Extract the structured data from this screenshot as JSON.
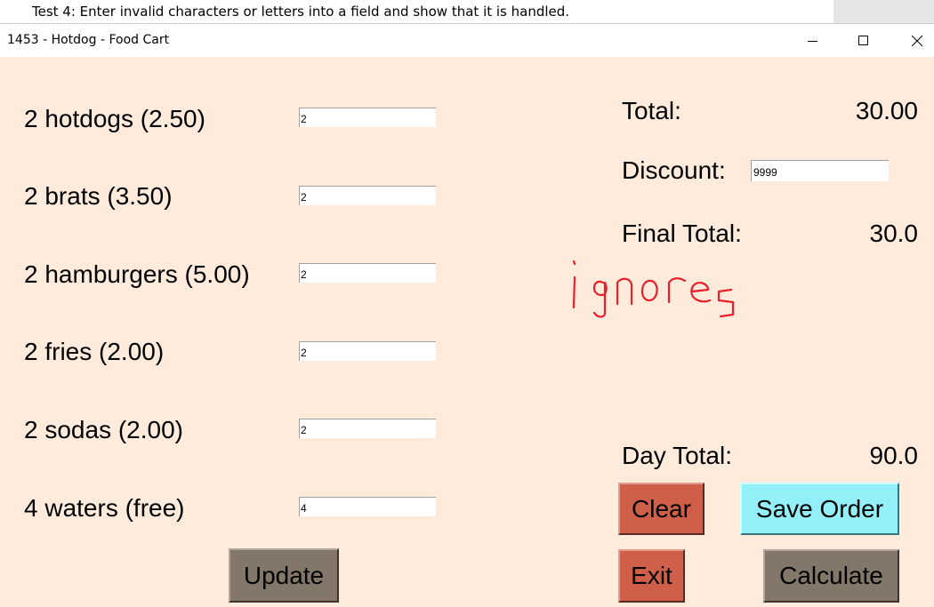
{
  "document": {
    "caption": "Test 4: Enter invalid characters or letters into a field and show that it is handled."
  },
  "window": {
    "title": "1453 - Hotdog - Food Cart",
    "controls": {
      "minimize_icon": "minimize-icon",
      "maximize_icon": "maximize-icon",
      "close_icon": "close-icon"
    }
  },
  "order_items": [
    {
      "label": "2 hotdogs (2.50)",
      "quantity": "2"
    },
    {
      "label": "2 brats (3.50)",
      "quantity": "2"
    },
    {
      "label": "2 hamburgers (5.00)",
      "quantity": "2"
    },
    {
      "label": "2 fries (2.00)",
      "quantity": "2"
    },
    {
      "label": "2 sodas (2.00)",
      "quantity": "2"
    },
    {
      "label": "4 waters (free)",
      "quantity": "4"
    }
  ],
  "summary": {
    "total_label": "Total:",
    "total_value": "30.00",
    "discount_label": "Discount:",
    "discount_value": "9999",
    "final_total_label": "Final Total:",
    "final_total_value": "30.0",
    "day_total_label": "Day Total:",
    "day_total_value": "90.0"
  },
  "annotation": {
    "handwritten_text": "ignores",
    "color": "#e8202a"
  },
  "buttons": {
    "update": "Update",
    "clear": "Clear",
    "save_order": "Save Order",
    "exit": "Exit",
    "calculate": "Calculate"
  },
  "colors": {
    "background": "#feebdb",
    "button_red": "#d05f4a",
    "button_gray": "#837769",
    "button_cyan": "#93f0f8"
  }
}
